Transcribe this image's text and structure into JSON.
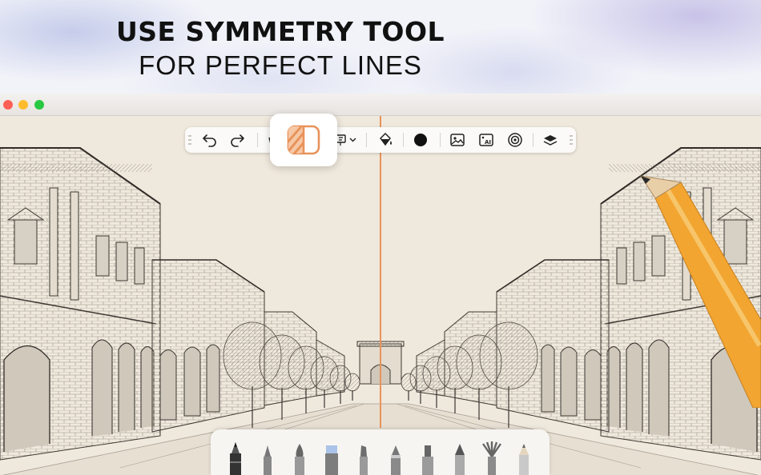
{
  "headline": {
    "line1": "USE SYMMETRY TOOL",
    "line2": "FOR PERFECT LINES"
  },
  "window": {
    "traffic_lights": [
      "close",
      "minimize",
      "zoom"
    ]
  },
  "toolbar": {
    "tools": [
      "undo-icon",
      "redo-icon",
      "selection-icon",
      "text-dropdown-icon",
      "fill-bucket-icon",
      "color-swatch",
      "image-icon",
      "ai-image-icon",
      "target-icon",
      "layers-icon"
    ]
  },
  "symmetry_popup": {
    "icon": "symmetry-icon"
  },
  "brushes": [
    "pen",
    "fine-liner",
    "ink-brush",
    "marker",
    "wedge",
    "round-brush",
    "chisel",
    "tip-brush",
    "fan-brush",
    "pencil"
  ],
  "colors": {
    "accent": "#e8935a",
    "color_swatch": "#111111",
    "paper": "#efe8dc"
  }
}
